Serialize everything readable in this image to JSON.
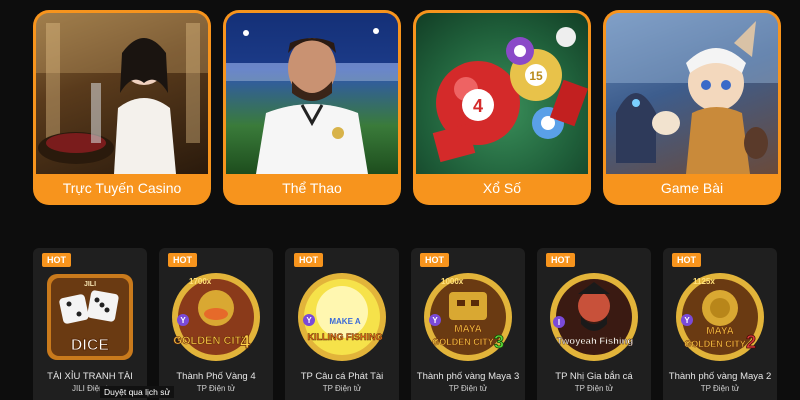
{
  "categories": [
    {
      "label": "Trực Tuyến Casino",
      "icon": "casino-dealer-image"
    },
    {
      "label": "Thể Thao",
      "icon": "football-player-image"
    },
    {
      "label": "Xổ Số",
      "icon": "lottery-balls-image"
    },
    {
      "label": "Game Bài",
      "icon": "fantasy-character-image"
    }
  ],
  "hot_label": "HOT",
  "games": [
    {
      "name": "TÀI XỈU TRANH TÀI",
      "provider": "JILI Điện t",
      "icon": "dice-game-icon",
      "badge": "",
      "icon_text": "DICE",
      "logo_text": "JILI"
    },
    {
      "name": "Thành Phố Vàng 4",
      "provider": "TP Điện tử",
      "icon": "golden-city-4-icon",
      "badge": "1700x",
      "icon_text": "GOLDEN CITY",
      "number": "4"
    },
    {
      "name": "TP Câu cá Phát Tài",
      "provider": "TP Điện tử",
      "icon": "killing-fishing-icon",
      "badge": "",
      "icon_text": "KILLING FISHING",
      "top_text": "MAKE A"
    },
    {
      "name": "Thành phố vàng Maya 3",
      "provider": "TP Điện tử",
      "icon": "maya-golden-city-3-icon",
      "badge": "1000x",
      "icon_text": "GOLDEN CITY",
      "top_text": "MAYA",
      "number": "3"
    },
    {
      "name": "TP Nhị Gia bắn cá",
      "provider": "TP Điện tử",
      "icon": "twoyeah-fishing-icon",
      "badge": "",
      "icon_text": "Twoyeah Fishing"
    },
    {
      "name": "Thành phố vàng Maya 2",
      "provider": "TP Điện tử",
      "icon": "maya-golden-city-2-icon",
      "badge": "1125x",
      "icon_text": "GOLDEN CITY",
      "top_text": "MAYA",
      "number": "2"
    }
  ],
  "tooltip": "Duyệt qua lịch sử",
  "colors": {
    "accent": "#f7941d",
    "tile_bg": "#1f1f1f",
    "page_bg": "#0d0d0d"
  }
}
